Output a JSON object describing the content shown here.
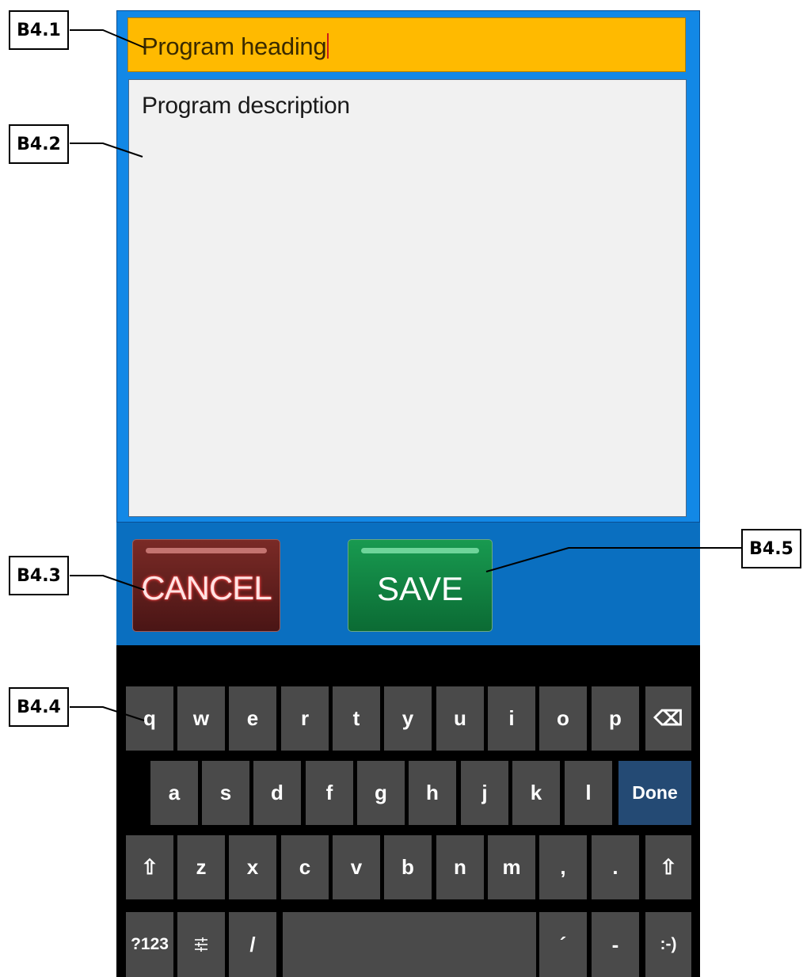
{
  "form": {
    "heading_value": "Program heading",
    "description_value": "Program description"
  },
  "buttons": {
    "cancel_label": "CANCEL",
    "save_label": "SAVE"
  },
  "keyboard": {
    "rows": [
      [
        "q",
        "w",
        "e",
        "r",
        "t",
        "y",
        "u",
        "i",
        "o",
        "p",
        "⌫"
      ],
      [
        "a",
        "s",
        "d",
        "f",
        "g",
        "h",
        "j",
        "k",
        "l",
        "Done"
      ],
      [
        "⇧",
        "z",
        "x",
        "c",
        "v",
        "b",
        "n",
        "m",
        ",",
        ".",
        "⇧"
      ],
      [
        "?123",
        "settings-icon",
        "/",
        "space-bar",
        "´",
        "-",
        ":-)"
      ]
    ]
  },
  "callouts": {
    "b4_1": "B4.1",
    "b4_2": "B4.2",
    "b4_3": "B4.3",
    "b4_4": "B4.4",
    "b4_5": "B4.5"
  },
  "colors": {
    "panel_blue": "#1288e6",
    "heading_amber": "#ffba00",
    "cancel_red": "#5a1c1a",
    "save_green": "#0f7a3c",
    "done_blue": "#244a74"
  }
}
